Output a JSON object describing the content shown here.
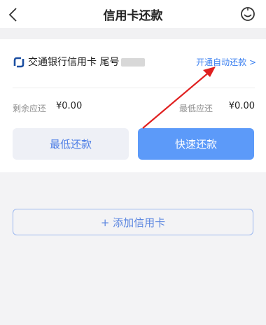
{
  "header": {
    "title": "信用卡还款",
    "back_icon": "back-chevron-icon",
    "service_icon": "customer-service-icon"
  },
  "card": {
    "bank_logo_icon": "bocom-logo-icon",
    "bank_name": "交通银行信用卡 尾号",
    "auto_repay_link": "开通自动还款 >",
    "remaining_label": "剩余应还",
    "remaining_value": "¥0.00",
    "minimum_label": "最低应还",
    "minimum_value": "¥0.00",
    "min_repay_button": "最低还款",
    "fast_repay_button": "快速还款"
  },
  "add_card_button": "+ 添加信用卡",
  "annotation": {
    "arrow_color": "#e02020"
  },
  "colors": {
    "accent": "#5c9af9",
    "link": "#3a7ff0",
    "background": "#f3f3f5"
  }
}
